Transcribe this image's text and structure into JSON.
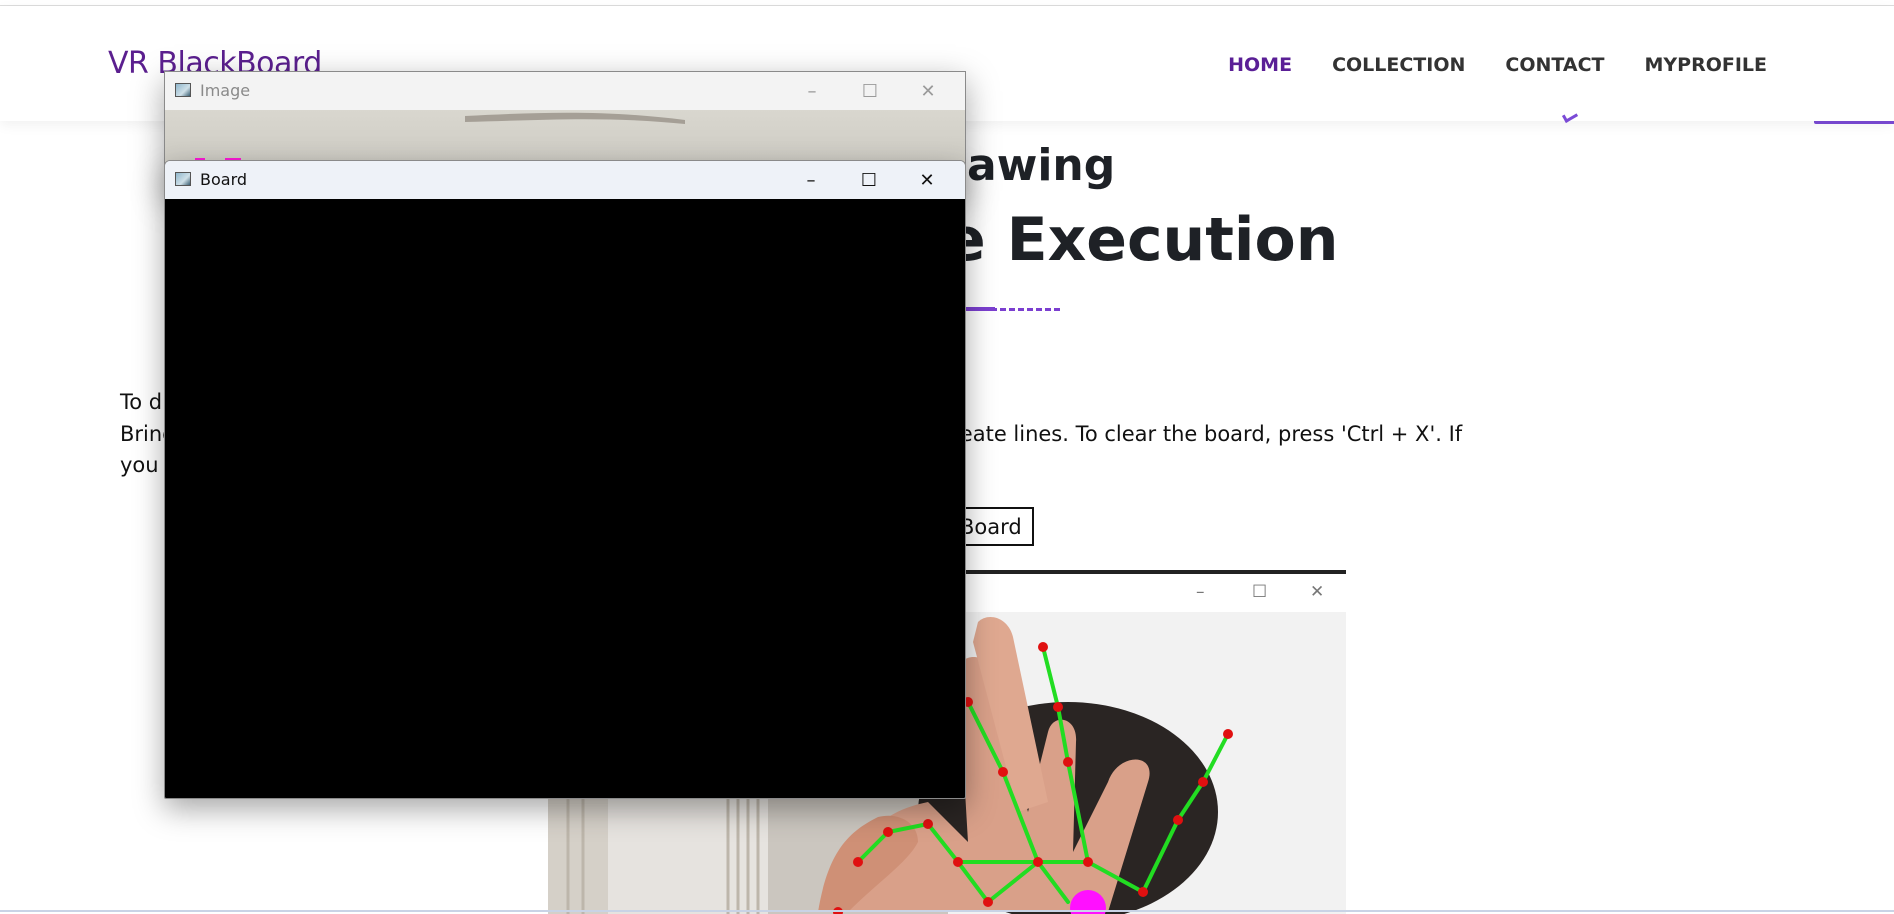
{
  "site": {
    "brand": "VR BlackBoard",
    "nav": [
      {
        "label": "HOME",
        "active": true
      },
      {
        "label": "COLLECTION",
        "active": false
      },
      {
        "label": "CONTACT",
        "active": false
      },
      {
        "label": "MYPROFILE",
        "active": false
      }
    ]
  },
  "main": {
    "heading_1": "awing",
    "heading_2": "e Execution",
    "paragraph_lines": [
      "To d",
      "Bring                                                                         fig.1), then move them to create lines. To clear the board, press 'Ctrl + X'. If",
      "you                                                                            your creativity!"
    ],
    "open_board_button": "Board"
  },
  "windows": {
    "image": {
      "title": "Image"
    },
    "board": {
      "title": "Board"
    },
    "figure": {
      "title": ""
    }
  },
  "controls": {
    "minimize": "–",
    "maximize": "☐",
    "close": "✕"
  },
  "colors": {
    "brand": "#5b1f8f",
    "accent": "#7b3fd0",
    "nav_active": "#5a1f96",
    "board_canvas": "#000000",
    "skeleton_line": "#22dd22",
    "landmark_point": "#e01010",
    "fingertip_marker": "#ff10ff"
  },
  "icons": {
    "window_app_icon": "opencv-window-icon",
    "minimize": "minimize-icon",
    "maximize": "maximize-icon",
    "close": "close-icon"
  }
}
